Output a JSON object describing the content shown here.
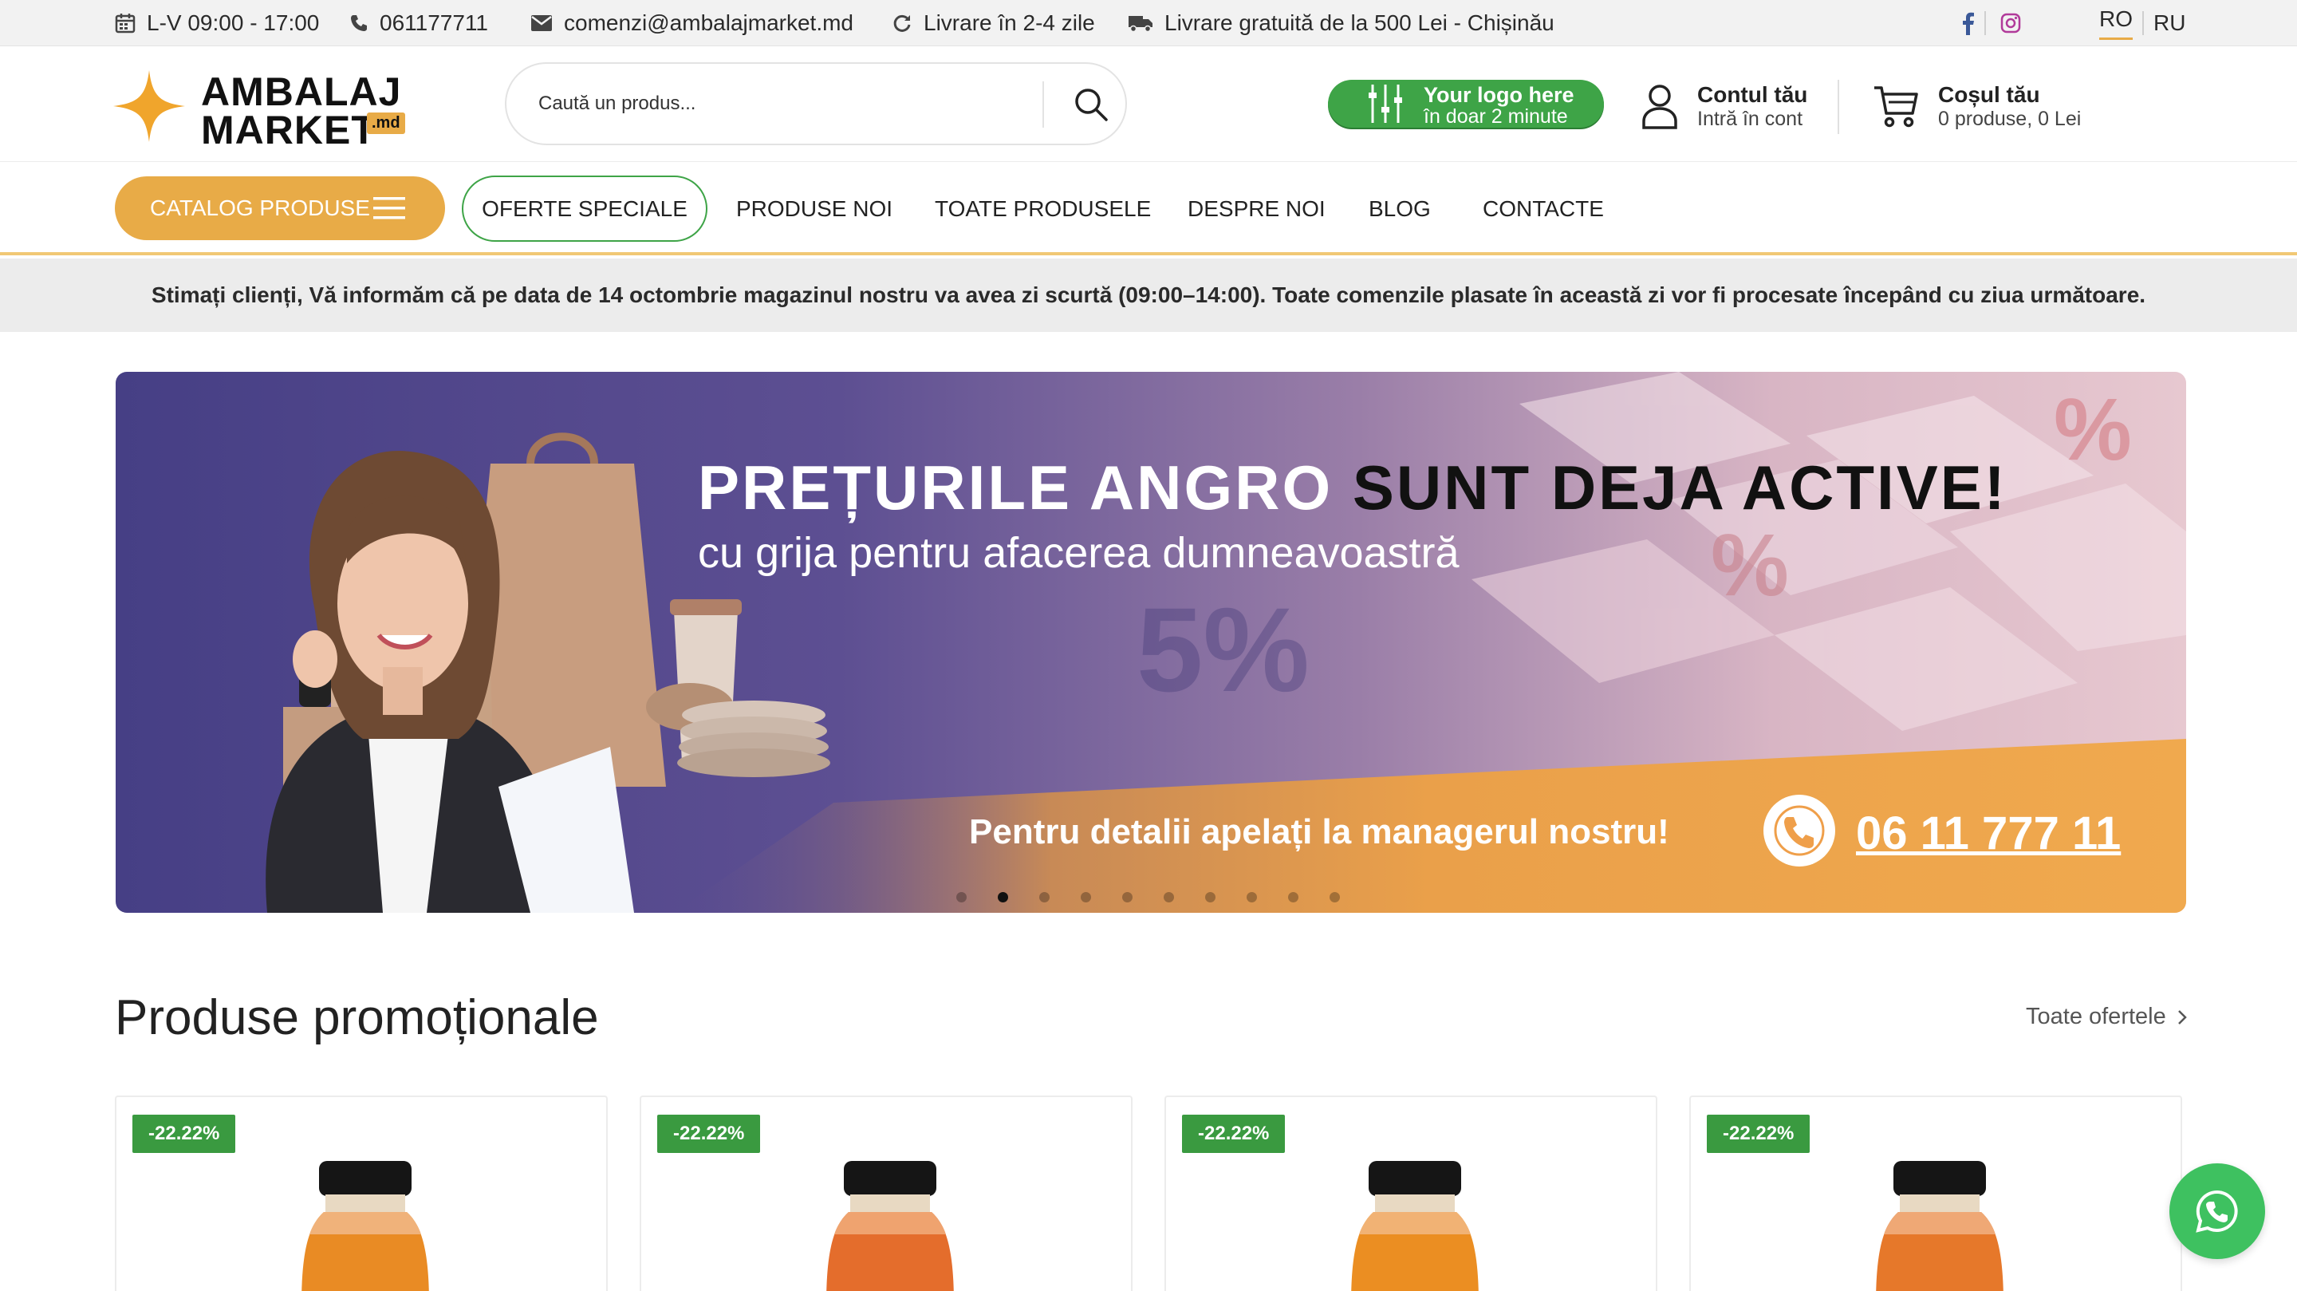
{
  "topbar": {
    "hours": "L-V 09:00 - 17:00",
    "phone": "061177711",
    "email": "comenzi@ambalajmarket.md",
    "delivery_time": "Livrare în 2-4 zile",
    "free_delivery": "Livrare gratuită de la 500 Lei - Chișinău",
    "languages": [
      "RO",
      "RU"
    ],
    "active_language": "RO"
  },
  "header": {
    "logo": {
      "line1": "AMBALAJ",
      "line2": "MARKET",
      "suffix": ".md"
    },
    "search": {
      "placeholder": "Caută un produs..."
    },
    "promo": {
      "line1": "Your logo here",
      "line2": "în doar 2 minute"
    },
    "account": {
      "title": "Contul tău",
      "subtitle": "Intră în cont"
    },
    "cart": {
      "title": "Coșul tău",
      "subtitle": "0 produse, 0 Lei"
    }
  },
  "nav": {
    "catalog": "CATALOG PRODUSE",
    "offers": "OFERTE SPECIALE",
    "links": [
      "PRODUSE NOI",
      "TOATE PRODUSELE",
      "DESPRE NOI",
      "BLOG",
      "CONTACTE"
    ]
  },
  "notice": "Stimați clienți, Vă informăm că pe data de 14 octombrie magazinul nostru va avea zi scurtă (09:00–14:00). Toate comenzile plasate în această zi vor fi procesate începând cu ziua următoare.",
  "banner": {
    "title_light": "PREȚURILE ANGRO",
    "title_dark": "SUNT DEJA ACTIVE!",
    "subtitle": "cu grija pentru afacerea dumneavoastră",
    "cta": "Pentru detalii apelați la managerul nostru!",
    "phone": "06 11 777 11",
    "slide_count": 10,
    "active_slide": 2
  },
  "promo_section": {
    "title": "Produse promoționale",
    "all_link": "Toate ofertele",
    "products": [
      {
        "discount": "-22.22%"
      },
      {
        "discount": "-22.22%"
      },
      {
        "discount": "-22.22%"
      },
      {
        "discount": "-22.22%"
      }
    ]
  },
  "colors": {
    "accent_orange": "#e8ab47",
    "accent_green": "#3ea447",
    "whatsapp_green": "#3ec160"
  }
}
